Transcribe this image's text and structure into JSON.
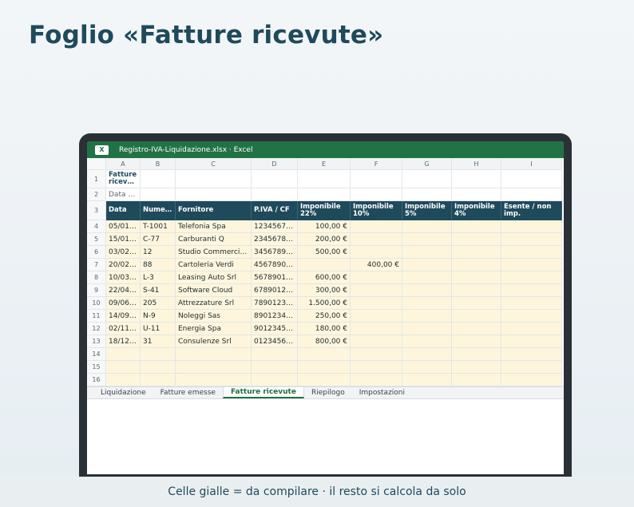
{
  "page_title": "Foglio «Fatture ricevute»",
  "window": {
    "badge": "X",
    "title": "Registro-IVA-Liquidazione.xlsx · Excel",
    "brand_color": "#217346"
  },
  "columns": [
    "A",
    "B",
    "C",
    "D",
    "E",
    "F",
    "G",
    "H",
    "I"
  ],
  "row_numbers": [
    "1",
    "2",
    "3",
    "4",
    "5",
    "6",
    "7",
    "8",
    "9",
    "10",
    "11",
    "12",
    "13",
    "14",
    "15",
    "16"
  ],
  "sheet": {
    "title": "Fatture ricev…",
    "subtitle": "Data …",
    "headers": [
      "Data",
      "Nume…",
      "Fornitore",
      "P.IVA / CF",
      "Imponibile 22%",
      "Imponibile 10%",
      "Imponibile 5%",
      "Imponibile 4%",
      "Esente / non imp."
    ],
    "rows": [
      [
        "05/01…",
        "T-1001",
        "Telefonia Spa",
        "1234567…",
        "100,00 €",
        "",
        "",
        "",
        ""
      ],
      [
        "15/01…",
        "C-77",
        "Carburanti Q",
        "2345678…",
        "200,00 €",
        "",
        "",
        "",
        ""
      ],
      [
        "03/02…",
        "12",
        "Studio Commerci…",
        "3456789…",
        "500,00 €",
        "",
        "",
        "",
        ""
      ],
      [
        "20/02…",
        "88",
        "Cartoleria Verdi",
        "4567890…",
        "",
        "400,00 €",
        "",
        "",
        ""
      ],
      [
        "10/03…",
        "L-3",
        "Leasing Auto Srl",
        "5678901…",
        "600,00 €",
        "",
        "",
        "",
        ""
      ],
      [
        "22/04…",
        "S-41",
        "Software Cloud",
        "6789012…",
        "300,00 €",
        "",
        "",
        "",
        ""
      ],
      [
        "09/06…",
        "205",
        "Attrezzature Srl",
        "7890123…",
        "1.500,00 €",
        "",
        "",
        "",
        ""
      ],
      [
        "14/09…",
        "N-9",
        "Noleggi Sas",
        "8901234…",
        "250,00 €",
        "",
        "",
        "",
        ""
      ],
      [
        "02/11…",
        "U-11",
        "Energia Spa",
        "9012345…",
        "180,00 €",
        "",
        "",
        "",
        ""
      ],
      [
        "18/12…",
        "31",
        "Consulenze Srl",
        "0123456…",
        "800,00 €",
        "",
        "",
        "",
        ""
      ],
      [
        "",
        "",
        "",
        "",
        "",
        "",
        "",
        "",
        ""
      ],
      [
        "",
        "",
        "",
        "",
        "",
        "",
        "",
        "",
        ""
      ],
      [
        "",
        "",
        "",
        "",
        "",
        "",
        "",
        "",
        ""
      ]
    ]
  },
  "tabs": [
    {
      "label": "Liquidazione",
      "active": false
    },
    {
      "label": "Fatture emesse",
      "active": false
    },
    {
      "label": "Fatture ricevute",
      "active": true
    },
    {
      "label": "Riepilogo",
      "active": false
    },
    {
      "label": "Impostazioni",
      "active": false
    }
  ],
  "caption": "Celle gialle = da compilare · il resto si calcola da solo",
  "colors": {
    "header_fill": "#1f4a5c",
    "input_fill": "#fdf6dc",
    "accent": "#217346"
  }
}
